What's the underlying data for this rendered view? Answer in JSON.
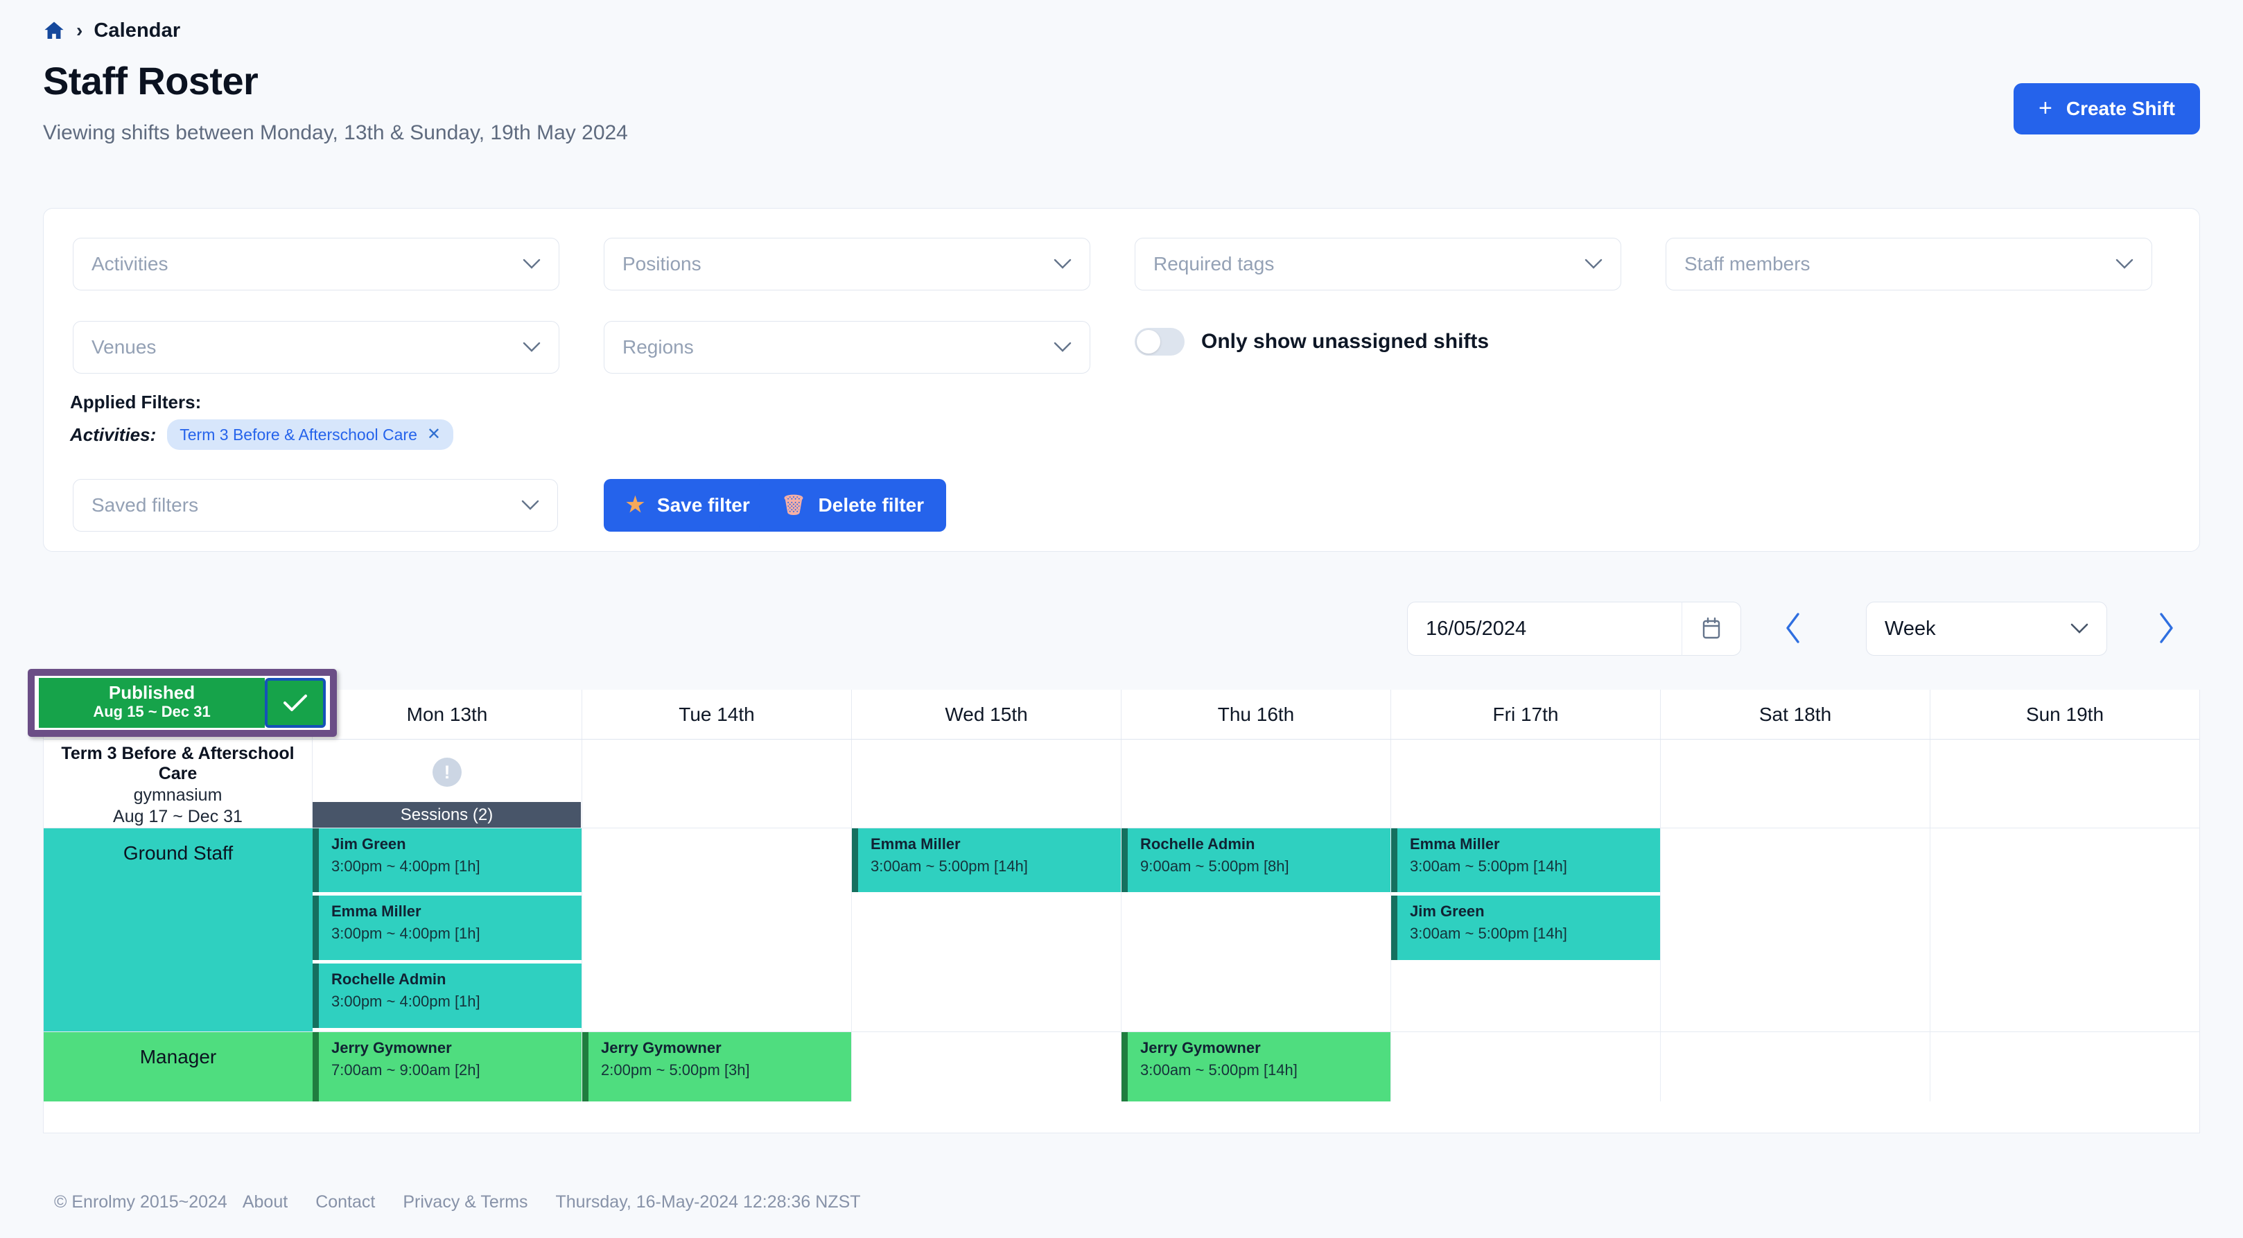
{
  "breadcrumb": {
    "home_icon": "home-icon",
    "separator": "›",
    "label": "Calendar"
  },
  "header": {
    "title": "Staff Roster",
    "subtitle": "Viewing shifts between Monday, 13th & Sunday, 19th May 2024",
    "create_shift_label": "Create Shift",
    "create_shift_plus": "+"
  },
  "filters": {
    "activities_placeholder": "Activities",
    "positions_placeholder": "Positions",
    "required_tags_placeholder": "Required tags",
    "staff_members_placeholder": "Staff members",
    "venues_placeholder": "Venues",
    "regions_placeholder": "Regions",
    "saved_filters_placeholder": "Saved filters",
    "toggle_label": "Only show unassigned shifts",
    "toggle_state": "off",
    "applied_title": "Applied Filters:",
    "applied_category": "Activities:",
    "applied_chip": "Term 3 Before & Afterschool Care",
    "applied_chip_close": "✕",
    "save_filter_label": "Save filter",
    "save_filter_icon": "★",
    "delete_filter_label": "Delete filter",
    "delete_filter_icon": "🗑"
  },
  "datenav": {
    "date_value": "16/05/2024",
    "calendar_icon": "calendar-icon",
    "prev_icon": "chevron-left-icon",
    "next_icon": "chevron-right-icon",
    "view_value": "Week"
  },
  "publish": {
    "status": "Published",
    "range": "Aug 15 ~ Dec 31",
    "confirm_icon": "check-icon"
  },
  "calendar": {
    "days": [
      "Mon 13th",
      "Tue 14th",
      "Wed 15th",
      "Thu 16th",
      "Fri 17th",
      "Sat 18th",
      "Sun 19th"
    ],
    "activity": {
      "name": "Term 3 Before & Afterschool Care",
      "venue": "gymnasium",
      "dates": "Aug 17 ~ Dec 31"
    },
    "meta_row": {
      "alert_icon": "!",
      "alert_day_index": 0,
      "sessions_label": "Sessions (2)",
      "sessions_day_index": 0
    },
    "rows": [
      {
        "label": "Ground Staff",
        "color": "#2fd0c0",
        "accent": "#15705f",
        "cells": [
          [
            {
              "who": "Jim Green",
              "when": "3:00pm ~ 4:00pm [1h]"
            },
            {
              "who": "Emma Miller",
              "when": "3:00pm ~ 4:00pm [1h]"
            },
            {
              "who": "Rochelle Admin",
              "when": "3:00pm ~ 4:00pm [1h]"
            }
          ],
          [],
          [
            {
              "who": "Emma Miller",
              "when": "3:00am ~ 5:00pm [14h]"
            }
          ],
          [
            {
              "who": "Rochelle Admin",
              "when": "9:00am ~ 5:00pm [8h]"
            }
          ],
          [
            {
              "who": "Emma Miller",
              "when": "3:00am ~ 5:00pm [14h]"
            },
            {
              "who": "Jim Green",
              "when": "3:00am ~ 5:00pm [14h]"
            }
          ],
          [],
          []
        ]
      },
      {
        "label": "Manager",
        "color": "#4fdd7f",
        "accent": "#1f7d3f",
        "cells": [
          [
            {
              "who": "Jerry Gymowner",
              "when": "7:00am ~ 9:00am [2h]"
            }
          ],
          [
            {
              "who": "Jerry Gymowner",
              "when": "2:00pm ~ 5:00pm [3h]"
            }
          ],
          [],
          [
            {
              "who": "Jerry Gymowner",
              "when": "3:00am ~ 5:00pm [14h]"
            }
          ],
          [],
          [],
          []
        ]
      }
    ]
  },
  "footer": {
    "copyright": "© Enrolmy  2015~2024",
    "about": "About",
    "contact": "Contact",
    "privacy": "Privacy & Terms",
    "timestamp": "Thursday, 16-May-2024 12:28:36 NZST"
  },
  "colors": {
    "accent_blue": "#2563eb",
    "ground_staff": "#2fd0c0",
    "manager": "#4fdd7f",
    "published_green": "#16a34a",
    "highlight_purple": "#6b4e86"
  }
}
